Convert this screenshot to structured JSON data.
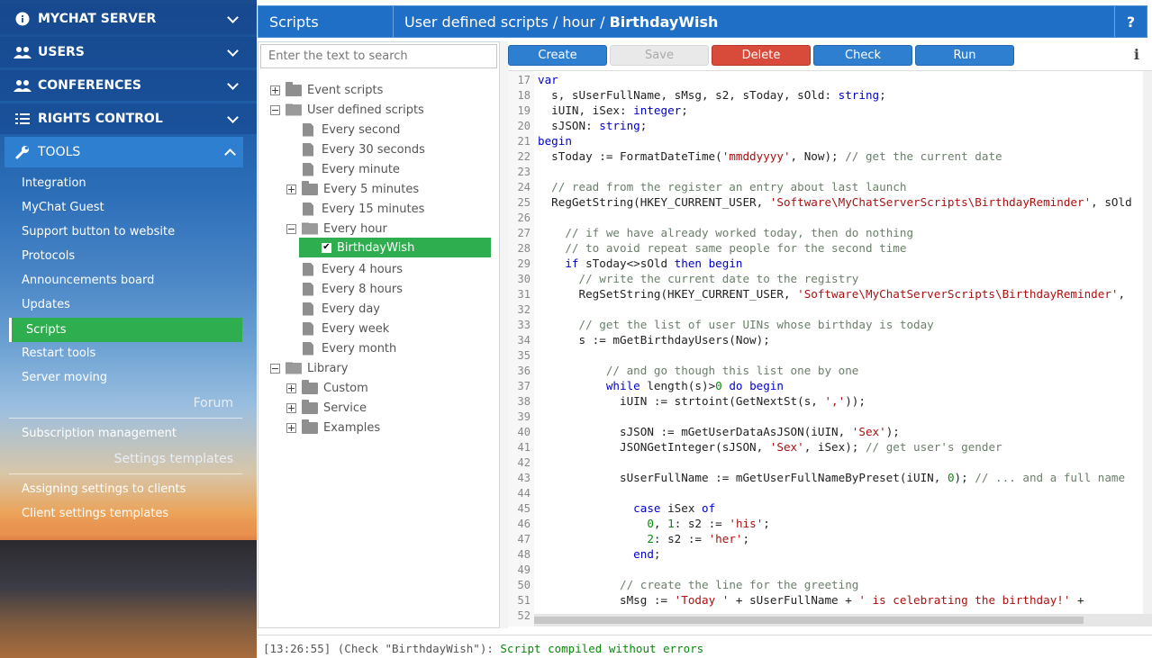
{
  "sidebar": {
    "mychat_server": "MYCHAT SERVER",
    "users": "USERS",
    "conferences": "CONFERENCES",
    "rights_control": "RIGHTS CONTROL",
    "tools": "TOOLS",
    "tools_items": [
      "Integration",
      "MyChat Guest",
      "Support button to website",
      "Protocols",
      "Announcements board",
      "Updates",
      "Scripts",
      "Restart tools",
      "Server moving"
    ],
    "forum_label": "Forum",
    "forum_items": [
      "Subscription management"
    ],
    "settings_templates_label": "Settings templates",
    "settings_items": [
      "Assigning settings to clients",
      "Client settings templates"
    ]
  },
  "topbar": {
    "section": "Scripts",
    "breadcrumb_path": "User defined scripts / hour / ",
    "breadcrumb_current": "BirthdayWish",
    "help": "?"
  },
  "search": {
    "placeholder": "Enter the text to search"
  },
  "tree": {
    "event_scripts": "Event scripts",
    "user_defined": "User defined scripts",
    "every_second": "Every second",
    "every_30_seconds": "Every 30 seconds",
    "every_minute": "Every minute",
    "every_5_minutes": "Every 5 minutes",
    "every_15_minutes": "Every 15 minutes",
    "every_hour": "Every hour",
    "birthday_wish": "BirthdayWish",
    "every_4_hours": "Every 4 hours",
    "every_8_hours": "Every 8 hours",
    "every_day": "Every day",
    "every_week": "Every week",
    "every_month": "Every month",
    "library": "Library",
    "custom": "Custom",
    "service": "Service",
    "examples": "Examples"
  },
  "toolbar": {
    "create": "Create",
    "save": "Save",
    "delete": "Delete",
    "check": "Check",
    "run": "Run",
    "info": "i"
  },
  "log": {
    "prefix": "[13:26:55] (Check \"BirthdayWish\"): ",
    "message": "Script compiled without errors"
  },
  "colors": {
    "accent": "#2f7fd0",
    "selected": "#2fae4f",
    "danger": "#d84a3a"
  }
}
